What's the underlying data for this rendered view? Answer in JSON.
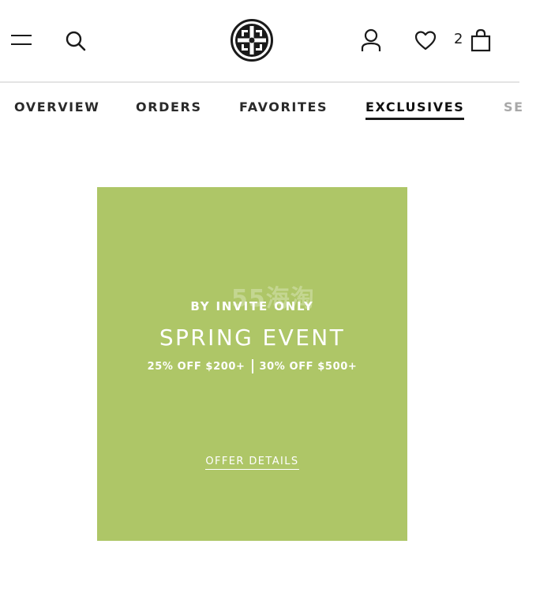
{
  "header": {
    "menu_icon": "menu-icon",
    "search_icon": "search-icon",
    "logo_icon": "tory-burch-logo",
    "account_icon": "account-icon",
    "favorites_icon": "heart-icon",
    "bag_icon": "shopping-bag-icon",
    "bag_count": "2"
  },
  "tabs": [
    {
      "label": "OVERVIEW",
      "active": false
    },
    {
      "label": "ORDERS",
      "active": false
    },
    {
      "label": "FAVORITES",
      "active": false
    },
    {
      "label": "EXCLUSIVES",
      "active": true
    },
    {
      "label": "SE",
      "active": false
    }
  ],
  "promo": {
    "background_color": "#aec667",
    "watermark": "55海淘",
    "eyebrow": "BY INVITE ONLY",
    "title": "SPRING EVENT",
    "offer_1": "25% OFF $200+",
    "offer_2": "30% OFF $500+",
    "link_label": "OFFER DETAILS"
  }
}
